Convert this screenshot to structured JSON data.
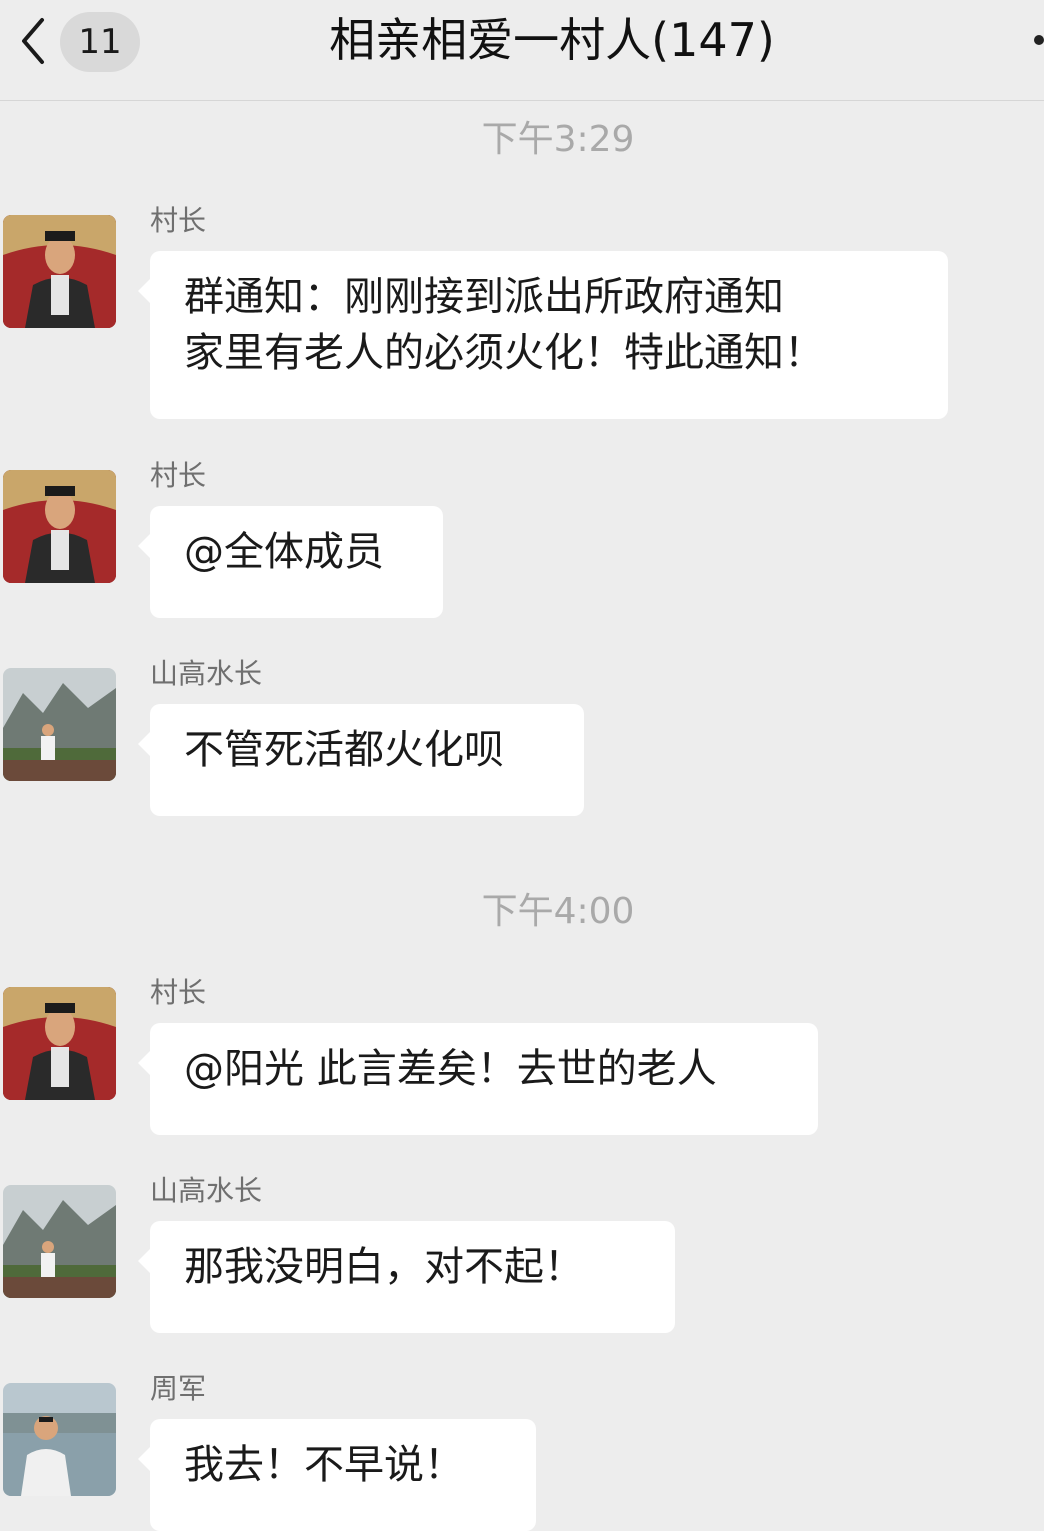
{
  "header": {
    "back_label": "<",
    "unread_count": "11",
    "title": "相亲相爱一村人(147)"
  },
  "timestamps": [
    "下午3:29",
    "下午4:00"
  ],
  "messages": [
    {
      "sender": "村长",
      "avatar": "village-chief-avatar",
      "text": "群通知：刚刚接到派出所政府通知\n家里有老人的必须火化！特此通知！"
    },
    {
      "sender": "村长",
      "avatar": "village-chief-avatar",
      "text": "@全体成员"
    },
    {
      "sender": "山高水长",
      "avatar": "mountain-avatar",
      "text": "不管死活都火化呗"
    },
    {
      "sender": "村长",
      "avatar": "village-chief-avatar",
      "text": "@阳光 此言差矣！去世的老人"
    },
    {
      "sender": "山高水长",
      "avatar": "mountain-avatar",
      "text": "那我没明白，对不起！"
    },
    {
      "sender": "周军",
      "avatar": "lake-avatar",
      "text": "我去！不早说！"
    }
  ],
  "colors": {
    "background": "#ededed",
    "bubble": "#ffffff",
    "timestamp": "#a9a9a9",
    "sender": "#6f6f6f"
  }
}
